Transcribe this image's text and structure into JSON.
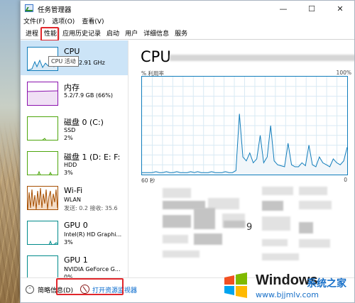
{
  "window": {
    "title": "任务管理器",
    "controls": {
      "minimize": "—",
      "maximize": "☐",
      "close": "✕"
    }
  },
  "menu": [
    "文件(F)",
    "选项(O)",
    "查看(V)"
  ],
  "tabs": [
    "进程",
    "性能",
    "应用历史记录",
    "启动",
    "用户",
    "详细信息",
    "服务"
  ],
  "active_tab": "性能",
  "sidebar": {
    "items": [
      {
        "name": "CPU",
        "sub1": "",
        "sub2": "2.91 GHz",
        "color": "#117dbb",
        "selected": true
      },
      {
        "name": "内存",
        "sub1": "5.2/7.9 GB (66%)",
        "sub2": "",
        "color": "#8b12ae",
        "selected": false
      },
      {
        "name": "磁盘 0 (C:)",
        "sub1": "SSD",
        "sub2": "2%",
        "color": "#4da60c",
        "selected": false
      },
      {
        "name": "磁盘 1 (D: E: F:",
        "sub1": "HDD",
        "sub2": "3%",
        "color": "#4da60c",
        "selected": false
      },
      {
        "name": "Wi-Fi",
        "sub1": "WLAN",
        "sub2": "发送: 0.2 接收: 35.6",
        "color": "#a74f01",
        "selected": false
      },
      {
        "name": "GPU 0",
        "sub1": "Intel(R) HD Graphi...",
        "sub2": "3%",
        "color": "#008b8b",
        "selected": false
      },
      {
        "name": "GPU 1",
        "sub1": "NVIDIA GeForce G...",
        "sub2": "0%",
        "color": "#008b8b",
        "selected": false
      }
    ],
    "tooltip": "CPU 活动"
  },
  "main": {
    "title": "CPU",
    "util_label": "% 利用率",
    "util_max": "100%",
    "time_left": "60 秒",
    "time_right": "0",
    "partial_value": "9",
    "graph_color": "#117dbb",
    "cpu_history": [
      2,
      2,
      2,
      2,
      3,
      2,
      2,
      3,
      2,
      2,
      3,
      2,
      2,
      2,
      3,
      2,
      3,
      2,
      2,
      2,
      3,
      2,
      2,
      2,
      3,
      2,
      2,
      4,
      62,
      18,
      14,
      22,
      12,
      16,
      40,
      12,
      18,
      50,
      14,
      10,
      9,
      8,
      32,
      10,
      8,
      8,
      12,
      9,
      30,
      10,
      8,
      18,
      12,
      10,
      8,
      16,
      12,
      10,
      14,
      28
    ]
  },
  "footer": {
    "fewer_details": "简略信息(D)",
    "open_monitor": "打开资源监视器"
  },
  "watermark": {
    "brand": "Windows",
    "site": "系统之家",
    "url": "www.bjjmlv.com"
  }
}
